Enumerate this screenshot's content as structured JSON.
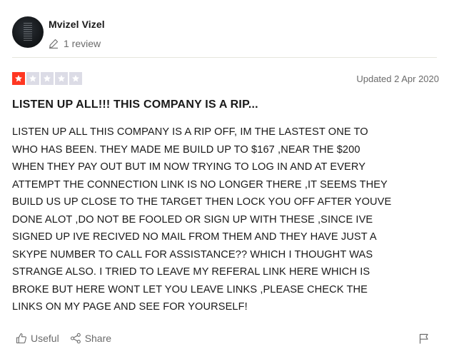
{
  "reviewer": {
    "name": "Mvizel Vizel",
    "review_count": "1 review"
  },
  "review": {
    "rating": 1,
    "rating_max": 5,
    "date": "Updated 2 Apr 2020",
    "title": "LISTEN UP ALL!!! THIS COMPANY IS A RIP...",
    "lines": [
      "LISTEN UP ALL THIS COMPANY IS A RIP OFF, IM THE LASTEST ONE TO",
      "WHO HAS BEEN. THEY MADE ME BUILD UP TO $167 ,NEAR THE $200",
      "WHEN THEY PAY OUT BUT IM NOW TRYING TO LOG IN AND AT EVERY",
      "ATTEMPT THE CONNECTION LINK IS NO LONGER THERE ,IT SEEMS THEY",
      "BUILD US UP CLOSE TO THE TARGET THEN LOCK YOU OFF AFTER YOUVE",
      "DONE ALOT ,DO NOT BE FOOLED OR SIGN UP WITH THESE ,SINCE IVE",
      "SIGNED UP IVE RECIVED NO MAIL FROM THEM AND THEY HAVE JUST A",
      "SKYPE NUMBER TO CALL FOR ASSISTANCE?? WHICH I THOUGHT WAS",
      "STRANGE ALSO. I TRIED TO LEAVE MY REFERAL LINK HERE WHICH IS",
      "BROKE BUT HERE WONT LET YOU LEAVE LINKS ,PLEASE CHECK THE",
      "LINKS ON MY PAGE AND SEE FOR YOURSELF!"
    ]
  },
  "actions": {
    "useful_label": "Useful",
    "share_label": "Share"
  },
  "icons": {
    "avatar": "avatar-image",
    "review_count": "pencil-icon",
    "star": "star-icon",
    "useful": "thumbs-up-icon",
    "share": "share-icon",
    "report": "flag-icon"
  },
  "colors": {
    "star_filled": "#ff3722",
    "star_empty": "#dcdce6",
    "muted_text": "#6b6b6b",
    "text": "#191919"
  }
}
